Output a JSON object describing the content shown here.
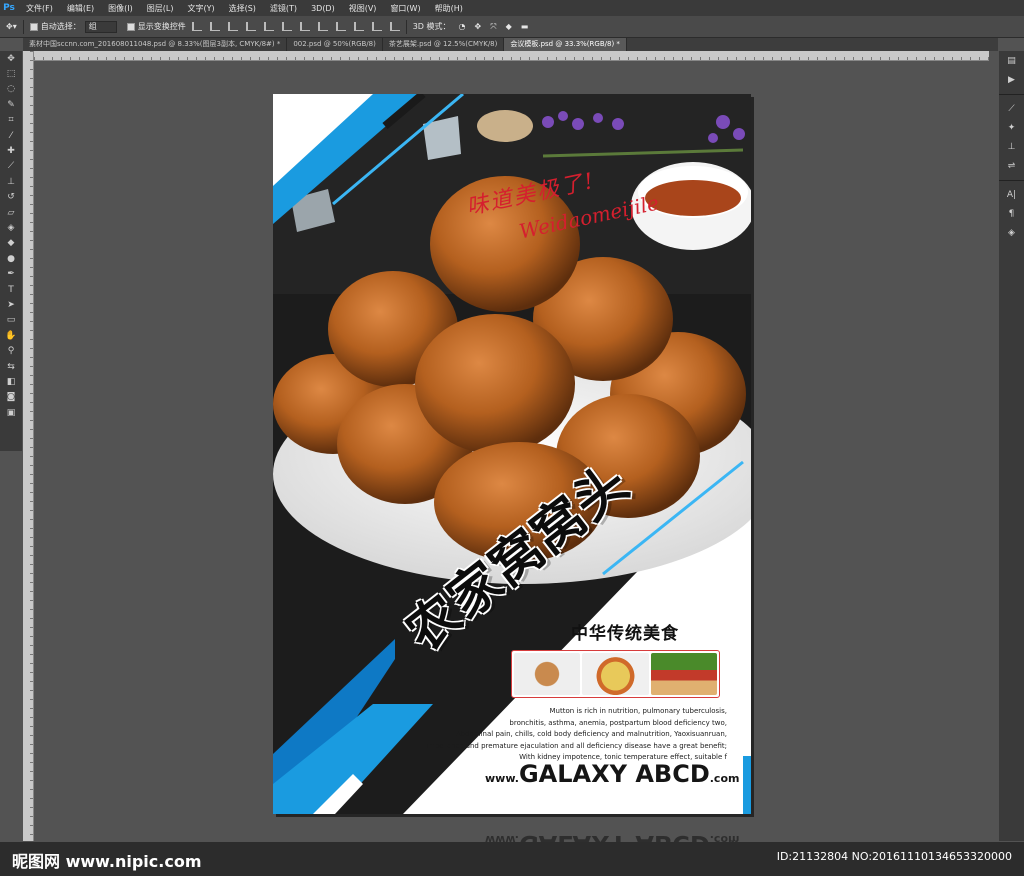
{
  "app": {
    "logo": "Ps"
  },
  "menu": [
    "文件(F)",
    "编辑(E)",
    "图像(I)",
    "图层(L)",
    "文字(Y)",
    "选择(S)",
    "滤镜(T)",
    "3D(D)",
    "视图(V)",
    "窗口(W)",
    "帮助(H)"
  ],
  "options": {
    "auto_select_label": "自动选择：",
    "auto_select_value": "组",
    "show_transform_label": "显示变换控件",
    "mode_label": "3D 模式："
  },
  "tabs": [
    {
      "label": "素材中国sccnn.com_201608011048.psd @ 8.33%(图层3副本, CMYK/8#) *"
    },
    {
      "label": "002.psd @ 50%(RGB/8)"
    },
    {
      "label": "茶艺展架.psd @ 12.5%(CMYK/8)"
    },
    {
      "label": "会议模板.psd @ 33.3%(RGB/8) *"
    }
  ],
  "poster": {
    "script_cn": "味道美极了!",
    "script_en": "Weidaomeijile",
    "title": "农家窝窝头",
    "subtitle": "中华传统美食",
    "desc_lines": [
      "Mutton is rich in nutrition, pulmonary tuberculosis,",
      "bronchitis, asthma, anemia, postpartum blood deficiency two,",
      "Abdominal pain, chills, cold body deficiency and malnutrition, Yaoxisuanruan,",
      "impotence and premature ejaculation and all deficiency disease have a great benefit;",
      "With kidney impotence, tonic temperature effect, suitable f"
    ],
    "website_prefix": "www.",
    "website_main": "GALAXY ABCD",
    "website_suffix": ".com"
  },
  "watermark": {
    "left": "昵图网 www.nipic.com",
    "right": "ID:21132804 NO:20161110134653320000"
  }
}
